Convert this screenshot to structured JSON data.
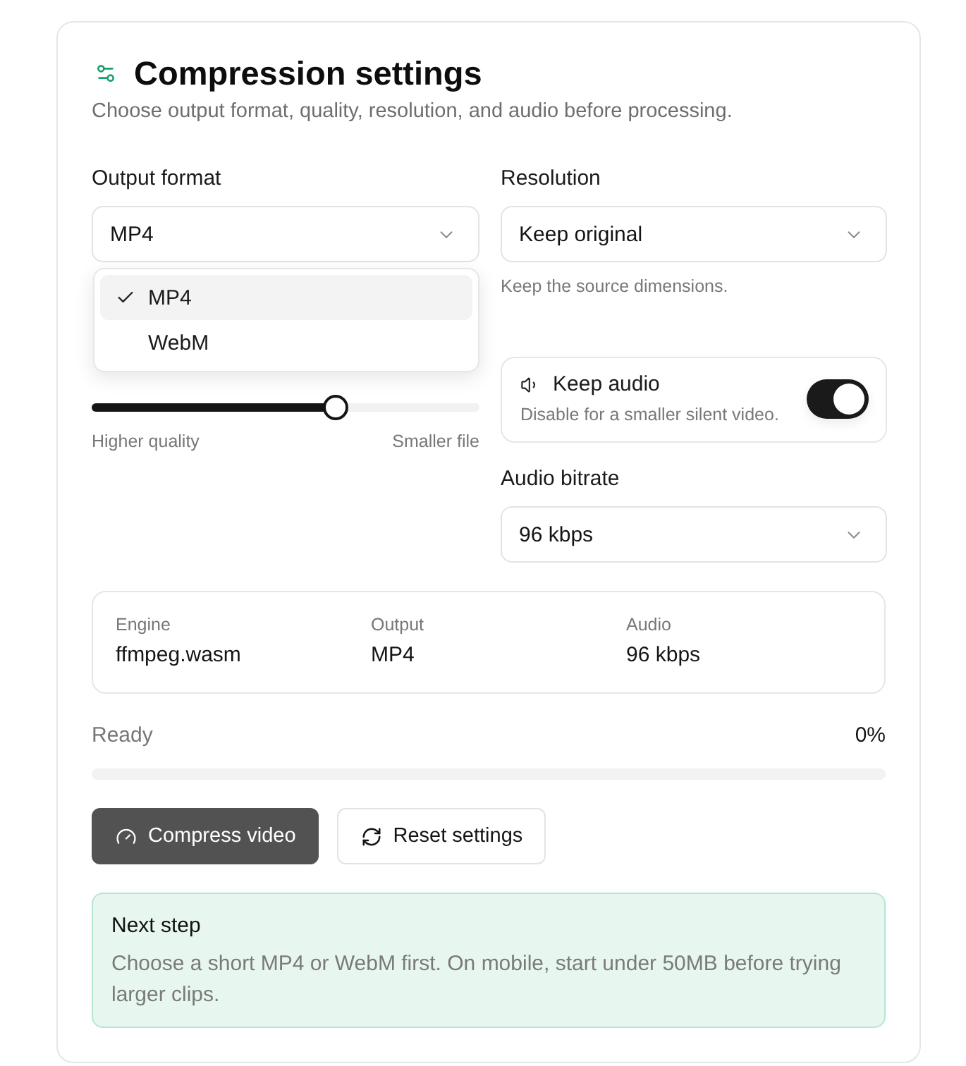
{
  "header": {
    "title": "Compression settings",
    "subtitle": "Choose output format, quality, resolution, and audio before processing."
  },
  "output_format": {
    "label": "Output format",
    "value": "MP4",
    "expanded": true,
    "options": [
      {
        "label": "MP4",
        "selected": true
      },
      {
        "label": "WebM",
        "selected": false
      }
    ]
  },
  "compression": {
    "level": 0.63,
    "min_label": "Higher quality",
    "max_label": "Smaller file"
  },
  "resolution": {
    "label": "Resolution",
    "value": "Keep original",
    "hint": "Keep the source dimensions."
  },
  "keep_audio": {
    "title": "Keep audio",
    "description": "Disable for a smaller silent video.",
    "on": true
  },
  "audio_bitrate": {
    "label": "Audio bitrate",
    "value": "96 kbps"
  },
  "summary": [
    {
      "label": "Engine",
      "value": "ffmpeg.wasm"
    },
    {
      "label": "Output",
      "value": "MP4"
    },
    {
      "label": "Audio",
      "value": "96 kbps"
    }
  ],
  "progress": {
    "status": "Ready",
    "reading": "0%",
    "level": 0
  },
  "buttons": [
    {
      "label": "Compress video",
      "kind": "primary"
    },
    {
      "label": "Reset settings",
      "kind": "secondary"
    }
  ],
  "note": {
    "title": "Next step",
    "body": "Choose a short MP4 or WebM first. On mobile, start under 50MB before trying larger clips."
  }
}
